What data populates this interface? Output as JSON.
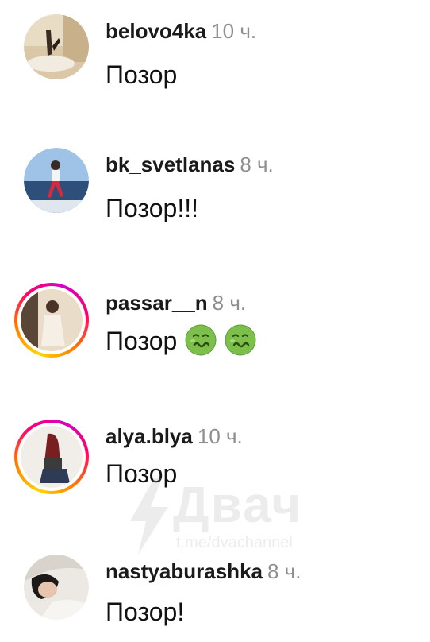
{
  "comments": [
    {
      "username": "belovo4ka",
      "time": "10 ч.",
      "text": "Позор",
      "has_story_ring": false,
      "emoji_count": 0
    },
    {
      "username": "bk_svetlanas",
      "time": "8 ч.",
      "text": "Позор!!!",
      "has_story_ring": false,
      "emoji_count": 0
    },
    {
      "username": "passar__n",
      "time": "8 ч.",
      "text": "Позор",
      "has_story_ring": true,
      "emoji_count": 2,
      "emoji": "nauseated-face"
    },
    {
      "username": "alya.blya",
      "time": "10 ч.",
      "text": "Позор",
      "has_story_ring": true,
      "emoji_count": 0
    },
    {
      "username": "nastyaburashka",
      "time": "8 ч.",
      "text": "Позор!",
      "has_story_ring": false,
      "emoji_count": 0
    }
  ],
  "watermark": {
    "title": "Двач",
    "subtitle": "t.me/dvachannel"
  },
  "colors": {
    "username": "#1a1a1a",
    "time": "#8e8e8e",
    "text": "#111111",
    "emoji_green": "#6cc24a"
  }
}
